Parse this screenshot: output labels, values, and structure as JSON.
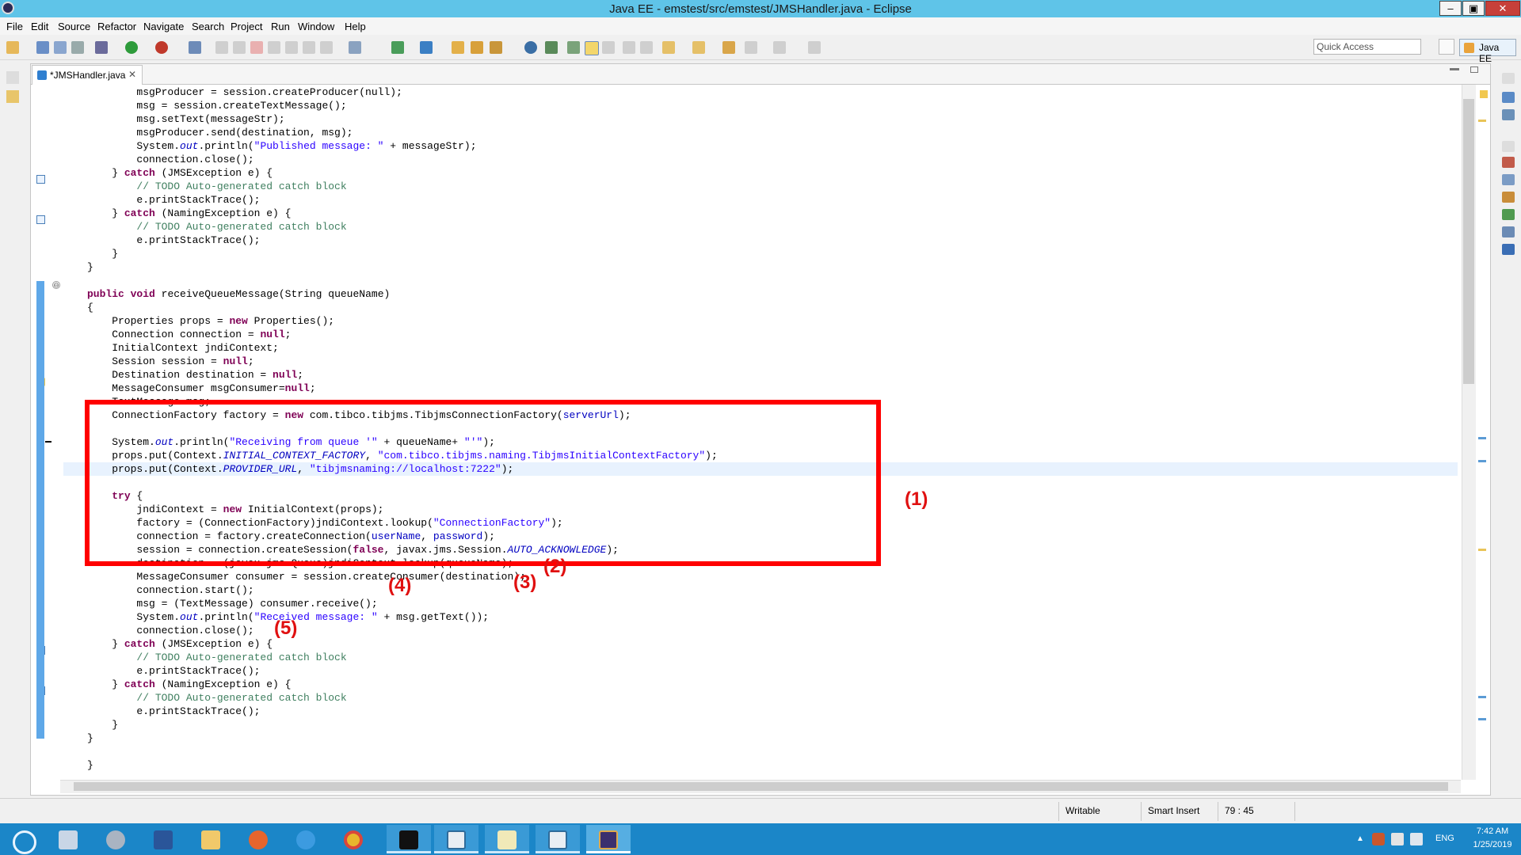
{
  "window": {
    "title": "Java EE - emstest/src/emstest/JMSHandler.java - Eclipse",
    "min_glyph": "–",
    "max_glyph": "▣",
    "close_glyph": "✕"
  },
  "menu": [
    "File",
    "Edit",
    "Source",
    "Refactor",
    "Navigate",
    "Search",
    "Project",
    "Run",
    "Window",
    "Help"
  ],
  "toolbar": {
    "quick_access_placeholder": "Quick Access",
    "perspective_label": "Java EE"
  },
  "editor": {
    "tab_label": "*JMSHandler.java",
    "tab_close": "✕",
    "lines": [
      [
        [
          "",
          "        msgProducer = session.createProducer(null);"
        ]
      ],
      [
        [
          "",
          "        msg = session.createTextMessage();"
        ]
      ],
      [
        [
          "",
          "        msg.setText(messageStr);"
        ]
      ],
      [
        [
          "",
          "        msgProducer.send(destination, msg);"
        ]
      ],
      [
        [
          "",
          "        System."
        ],
        [
          "fld",
          "out"
        ],
        [
          "",
          ".println("
        ],
        [
          "str",
          "\"Published message: \""
        ],
        [
          "",
          " + messageStr);"
        ]
      ],
      [
        [
          "",
          "        connection.close();"
        ]
      ],
      [
        [
          "",
          "    } "
        ],
        [
          "kw",
          "catch"
        ],
        [
          "",
          " (JMSException e) {"
        ]
      ],
      [
        [
          "cm",
          "        // TODO Auto-generated catch block"
        ]
      ],
      [
        [
          "",
          "        e.printStackTrace();"
        ]
      ],
      [
        [
          "",
          "    } "
        ],
        [
          "kw",
          "catch"
        ],
        [
          "",
          " (NamingException e) {"
        ]
      ],
      [
        [
          "cm",
          "        // TODO Auto-generated catch block"
        ]
      ],
      [
        [
          "",
          "        e.printStackTrace();"
        ]
      ],
      [
        [
          "",
          "    }"
        ]
      ],
      [
        [
          "",
          "}"
        ]
      ],
      [
        [
          "",
          ""
        ]
      ],
      [
        [
          "kw",
          "public"
        ],
        [
          "",
          " "
        ],
        [
          "kw",
          "void"
        ],
        [
          "",
          " receiveQueueMessage(String queueName)"
        ]
      ],
      [
        [
          "",
          "{"
        ]
      ],
      [
        [
          "",
          "    Properties props = "
        ],
        [
          "kw",
          "new"
        ],
        [
          "",
          " Properties();"
        ]
      ],
      [
        [
          "",
          "    Connection connection = "
        ],
        [
          "kw",
          "null"
        ],
        [
          "",
          ";"
        ]
      ],
      [
        [
          "",
          "    InitialContext jndiContext;"
        ]
      ],
      [
        [
          "",
          "    Session session = "
        ],
        [
          "kw",
          "null"
        ],
        [
          "",
          ";"
        ]
      ],
      [
        [
          "",
          "    Destination destination = "
        ],
        [
          "kw",
          "null"
        ],
        [
          "",
          ";"
        ]
      ],
      [
        [
          "",
          "    MessageConsumer msgConsumer="
        ],
        [
          "kw",
          "null"
        ],
        [
          "",
          ";"
        ]
      ],
      [
        [
          "",
          "    TextMessage msg;"
        ]
      ],
      [
        [
          "",
          "    ConnectionFactory factory = "
        ],
        [
          "kw",
          "new"
        ],
        [
          "",
          " com.tibco.tibjms.TibjmsConnectionFactory("
        ],
        [
          "fldn",
          "serverUrl"
        ],
        [
          "",
          ");"
        ]
      ],
      [
        [
          "",
          ""
        ]
      ],
      [
        [
          "",
          "    System."
        ],
        [
          "fld",
          "out"
        ],
        [
          "",
          ".println("
        ],
        [
          "str",
          "\"Receiving from queue '\""
        ],
        [
          "",
          " + queueName+ "
        ],
        [
          "str",
          "\"'\""
        ],
        [
          "",
          ");"
        ]
      ],
      [
        [
          "",
          "    props.put(Context."
        ],
        [
          "fld",
          "INITIAL_CONTEXT_FACTORY"
        ],
        [
          "",
          ", "
        ],
        [
          "str",
          "\"com.tibco.tibjms.naming.TibjmsInitialContextFactory\""
        ],
        [
          "",
          ");"
        ]
      ],
      [
        [
          "",
          "    props.put(Context."
        ],
        [
          "fld",
          "PROVIDER_URL"
        ],
        [
          "",
          ", "
        ],
        [
          "str",
          "\"tibjmsnaming://localhost:7222\""
        ],
        [
          "",
          ");"
        ]
      ],
      [
        [
          "",
          ""
        ]
      ],
      [
        [
          "",
          "    "
        ],
        [
          "kw",
          "try"
        ],
        [
          "",
          " {"
        ]
      ],
      [
        [
          "",
          "        jndiContext = "
        ],
        [
          "kw",
          "new"
        ],
        [
          "",
          " InitialContext(props);"
        ]
      ],
      [
        [
          "",
          "        factory = (ConnectionFactory)jndiContext.lookup("
        ],
        [
          "str",
          "\"ConnectionFactory\""
        ],
        [
          "",
          ");"
        ]
      ],
      [
        [
          "",
          "        connection = factory.createConnection("
        ],
        [
          "fldn",
          "userName"
        ],
        [
          "",
          ", "
        ],
        [
          "fldn",
          "password"
        ],
        [
          "",
          ");"
        ]
      ],
      [
        [
          "",
          "        session = connection.createSession("
        ],
        [
          "kw",
          "false"
        ],
        [
          "",
          ", javax.jms.Session."
        ],
        [
          "fld",
          "AUTO_ACKNOWLEDGE"
        ],
        [
          "",
          ");"
        ]
      ],
      [
        [
          "",
          "        destination = (javax.jms.Queue)jndiContext.lookup(queueName);"
        ]
      ],
      [
        [
          "",
          "        MessageConsumer consumer = session.createConsumer(destination);"
        ]
      ],
      [
        [
          "",
          "        connection.start();"
        ]
      ],
      [
        [
          "",
          "        msg = (TextMessage) consumer.receive();"
        ]
      ],
      [
        [
          "",
          "        System."
        ],
        [
          "fld",
          "out"
        ],
        [
          "",
          ".println("
        ],
        [
          "str",
          "\"Received message: \""
        ],
        [
          "",
          " + msg.getText());"
        ]
      ],
      [
        [
          "",
          "        connection.close();"
        ]
      ],
      [
        [
          "",
          "    } "
        ],
        [
          "kw",
          "catch"
        ],
        [
          "",
          " (JMSException e) {"
        ]
      ],
      [
        [
          "cm",
          "        // TODO Auto-generated catch block"
        ]
      ],
      [
        [
          "",
          "        e.printStackTrace();"
        ]
      ],
      [
        [
          "",
          "    } "
        ],
        [
          "kw",
          "catch"
        ],
        [
          "",
          " (NamingException e) {"
        ]
      ],
      [
        [
          "cm",
          "        // TODO Auto-generated catch block"
        ]
      ],
      [
        [
          "",
          "        e.printStackTrace();"
        ]
      ],
      [
        [
          "",
          "    }"
        ]
      ],
      [
        [
          "",
          "}"
        ]
      ],
      [
        [
          "",
          ""
        ]
      ],
      [
        [
          "",
          "}"
        ]
      ]
    ]
  },
  "annotations": {
    "a1": "(1)",
    "a2": "(2)",
    "a3": "(3)",
    "a4": "(4)",
    "a5": "(5)"
  },
  "status": {
    "writable": "Writable",
    "insert_mode": "Smart Insert",
    "position": "79 : 45"
  },
  "taskbar": {
    "lang": "ENG",
    "time": "7:42 AM",
    "date": "1/25/2019"
  }
}
